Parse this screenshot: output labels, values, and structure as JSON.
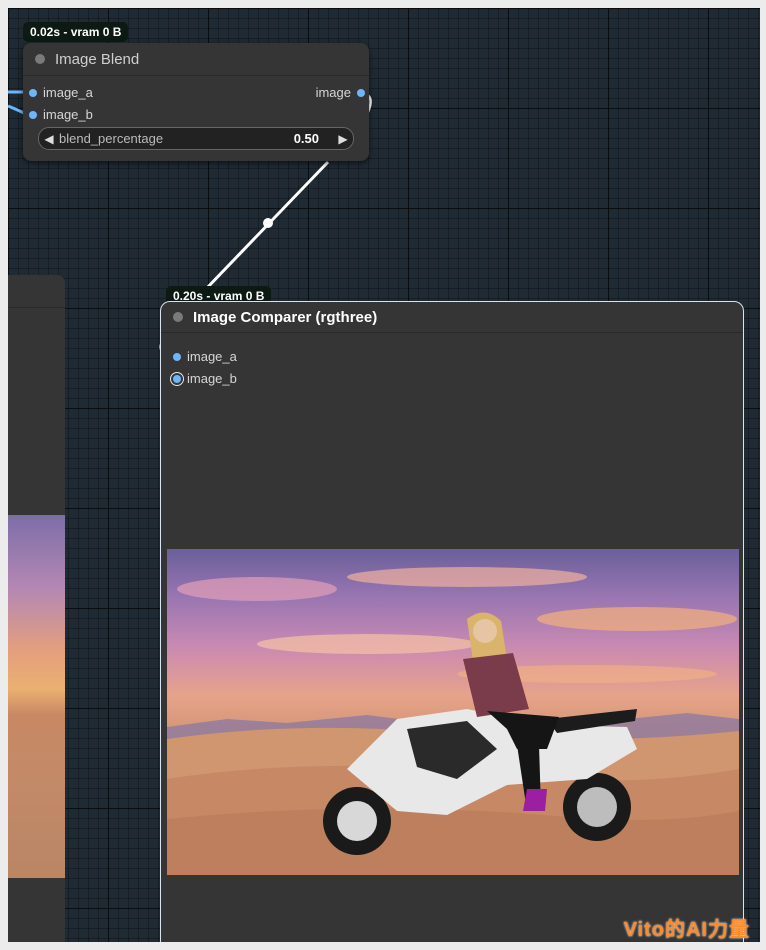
{
  "blend_node": {
    "timing": "0.02s - vram 0 B",
    "title": "Image Blend",
    "inputs": [
      "image_a",
      "image_b"
    ],
    "output": "image",
    "widget": {
      "label": "blend_percentage",
      "value": "0.50"
    }
  },
  "comparer_node": {
    "timing": "0.20s - vram 0 B",
    "title": "Image Comparer (rgthree)",
    "inputs": [
      "image_a",
      "image_b"
    ]
  },
  "watermark": "Vito的AI力量",
  "colors": {
    "canvas": "#202a33",
    "node": "#353535",
    "socket": "#6cb6ff",
    "link": "#ffffff",
    "badge": "#0d1a14",
    "watermark": "#ff8a2a"
  },
  "icons": [
    "node-status-dot",
    "socket-dot",
    "decrement-arrow",
    "increment-arrow"
  ]
}
